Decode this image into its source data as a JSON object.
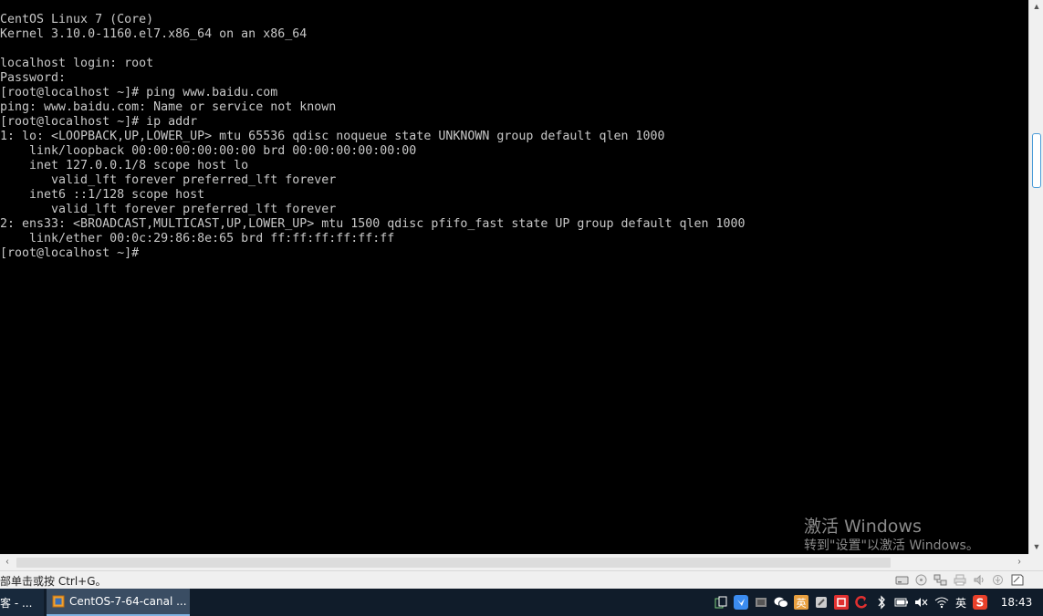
{
  "terminal": {
    "lines": [
      "CentOS Linux 7 (Core)",
      "Kernel 3.10.0-1160.el7.x86_64 on an x86_64",
      "",
      "localhost login: root",
      "Password:",
      "[root@localhost ~]# ping www.baidu.com",
      "ping: www.baidu.com: Name or service not known",
      "[root@localhost ~]# ip addr",
      "1: lo: <LOOPBACK,UP,LOWER_UP> mtu 65536 qdisc noqueue state UNKNOWN group default qlen 1000",
      "    link/loopback 00:00:00:00:00:00 brd 00:00:00:00:00:00",
      "    inet 127.0.0.1/8 scope host lo",
      "       valid_lft forever preferred_lft forever",
      "    inet6 ::1/128 scope host",
      "       valid_lft forever preferred_lft forever",
      "2: ens33: <BROADCAST,MULTICAST,UP,LOWER_UP> mtu 1500 qdisc pfifo_fast state UP group default qlen 1000",
      "    link/ether 00:0c:29:86:8e:65 brd ff:ff:ff:ff:ff:ff",
      "[root@localhost ~]#"
    ]
  },
  "watermark": {
    "title": "激活 Windows",
    "subtitle": "转到\"设置\"以激活 Windows。"
  },
  "statusbar": {
    "hint": "部单击或按 Ctrl+G。",
    "icons": [
      "hard-disk-icon",
      "cd-icon",
      "network-icon",
      "printer-icon",
      "sound-icon",
      "usb-icon",
      "message-icon"
    ]
  },
  "taskbar": {
    "items": [
      {
        "label": "客 - ...",
        "active": false
      },
      {
        "label": "CentOS-7-64-canal ...",
        "active": true
      }
    ],
    "tray": {
      "ime_label": "英",
      "time": "18:43"
    }
  },
  "colors": {
    "terminal_fg": "#c8c8c8",
    "terminal_bg": "#000000",
    "taskbar_bg": "#101c2a",
    "scroll_accent": "#4a9bd8"
  }
}
